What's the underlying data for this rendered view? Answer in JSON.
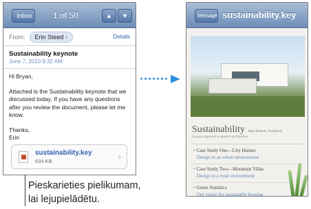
{
  "email": {
    "inbox_label": "Inbox",
    "counter": "1 of 50",
    "from_label": "From:",
    "sender": "Erin Steed",
    "details_label": "Details",
    "subject": "Sustainability keynote",
    "date": "June 7, 2010 9:32 AM",
    "greeting": "Hi Bryan,",
    "body": "Attached is the Sustainability keynote that we discussed today. If you have any questions after you review the document, please let me know.",
    "signoff_1": "Thanks,",
    "signoff_2": "Erin",
    "attachment": {
      "name": "sustainability.key",
      "size": "534 KB"
    }
  },
  "preview": {
    "back_label": "Message",
    "title": "sustainability.key",
    "doc_title": "Sustainability",
    "doc_byline": "Janet Roberts, Architects",
    "doc_subtitle": "A green approach to modern architecture",
    "items": [
      {
        "heading": "Case Study One—City Homes",
        "sub": "Design in an urban environment"
      },
      {
        "heading": "Case Study Two—Mountain Villas",
        "sub": "Design in a rural environment"
      },
      {
        "heading": "Green Statistics",
        "sub": "Our vision for sustainable housing"
      }
    ]
  },
  "callout": {
    "line1": "Pieskarieties pielikumam,",
    "line2": "lai lejupielādētu."
  },
  "colors": {
    "accent": "#2d8fe0",
    "link": "#2f62b4",
    "navbar": "#6e8db7"
  }
}
